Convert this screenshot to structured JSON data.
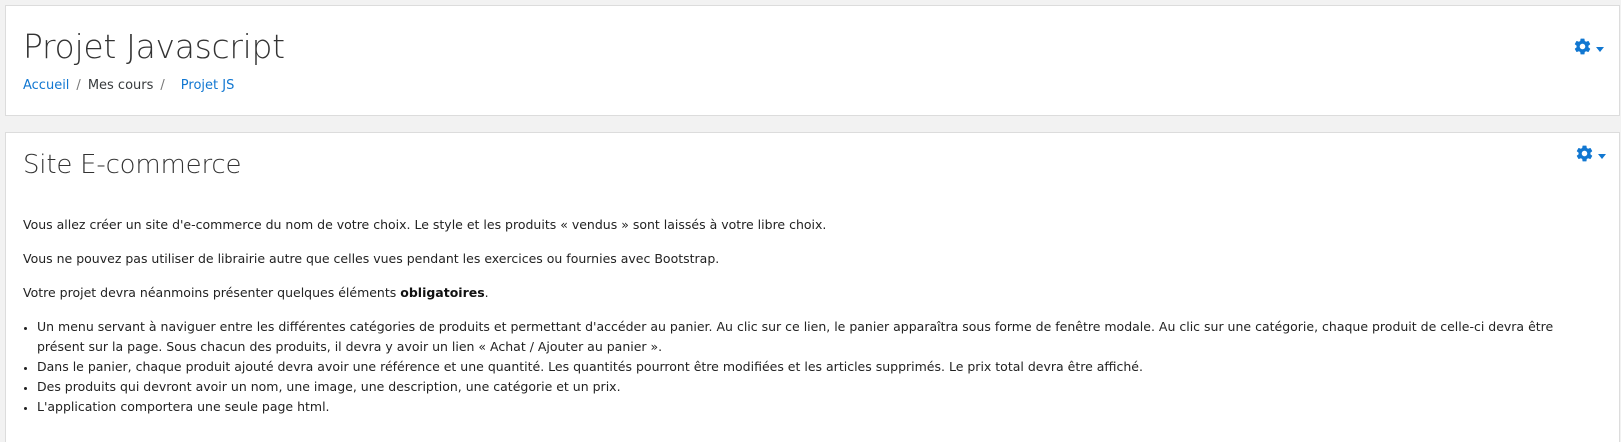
{
  "header": {
    "title": "Projet Javascript",
    "breadcrumb": [
      {
        "label": "Accueil",
        "link": true
      },
      {
        "label": "Mes cours",
        "link": false
      },
      {
        "label": "Projet JS",
        "link": true
      }
    ],
    "separator": "/"
  },
  "section": {
    "title": "Site E-commerce",
    "paragraphs": [
      "Vous allez créer un site d'e-commerce du nom de votre choix. Le style et les produits « vendus » sont laissés à votre libre choix.",
      "Vous ne pouvez pas utiliser de librairie autre que celles vues pendant les exercices ou fournies avec Bootstrap."
    ],
    "intro_prefix": "Votre projet devra néanmoins présenter quelques éléments ",
    "intro_bold": "obligatoires",
    "intro_suffix": ".",
    "list": [
      "Un menu servant à naviguer entre les différentes catégories de produits et permettant d'accéder au panier. Au clic sur ce lien, le panier apparaîtra sous forme de fenêtre modale. Au clic sur une catégorie, chaque produit de celle-ci devra être présent sur la page. Sous chacun des produits, il devra y avoir un lien « Achat / Ajouter au panier ».",
      "Dans le panier, chaque produit ajouté devra avoir une référence et une quantité. Les quantités pourront être modifiées et les articles supprimés. Le prix total devra être affiché.",
      "Des produits qui devront avoir un nom, une image, une description, une catégorie et un prix.",
      "L'application comportera une seule page html."
    ]
  },
  "icons": {
    "header_menu": "gear-icon",
    "section_menu": "gear-icon"
  },
  "colors": {
    "link": "#1177d1",
    "background": "#f2f2f2",
    "card": "#ffffff"
  }
}
